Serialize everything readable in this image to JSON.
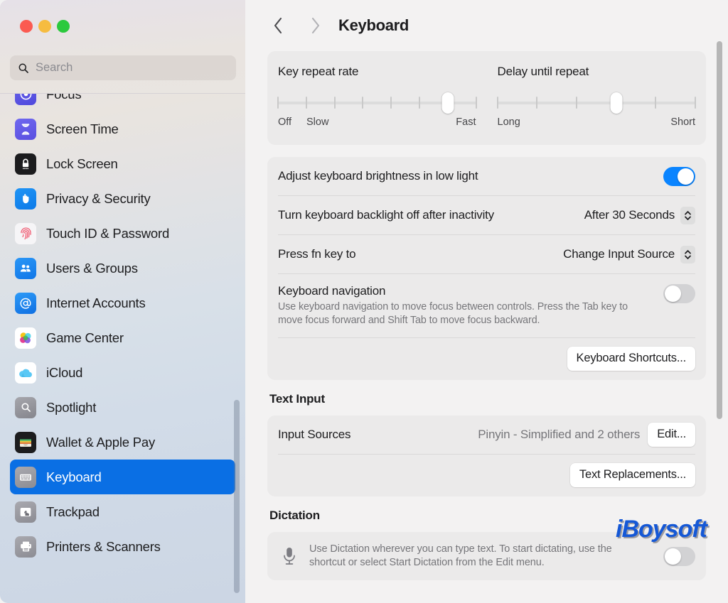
{
  "window": {
    "traffic_lights": [
      "close",
      "minimize",
      "zoom"
    ],
    "colors": {
      "accent": "#0a84ff",
      "selection": "#0a6fe4",
      "card": "#ebeaea",
      "watermark": "#1558d6"
    }
  },
  "sidebar": {
    "search": {
      "placeholder": "Search",
      "value": "",
      "icon": "search-icon"
    },
    "items": [
      {
        "label": "Focus",
        "icon": "focus-icon",
        "selected": false,
        "partial": true
      },
      {
        "label": "Screen Time",
        "icon": "screen-time-icon",
        "selected": false
      },
      {
        "label": "Lock Screen",
        "icon": "lock-icon",
        "selected": false
      },
      {
        "label": "Privacy & Security",
        "icon": "hand-icon",
        "selected": false
      },
      {
        "label": "Touch ID & Password",
        "icon": "fingerprint-icon",
        "selected": false
      },
      {
        "label": "Users & Groups",
        "icon": "users-icon",
        "selected": false
      },
      {
        "label": "Internet Accounts",
        "icon": "at-sign-icon",
        "selected": false
      },
      {
        "label": "Game Center",
        "icon": "game-center-icon",
        "selected": false
      },
      {
        "label": "iCloud",
        "icon": "cloud-icon",
        "selected": false
      },
      {
        "label": "Spotlight",
        "icon": "spotlight-icon",
        "selected": false
      },
      {
        "label": "Wallet & Apple Pay",
        "icon": "wallet-icon",
        "selected": false
      },
      {
        "label": "Keyboard",
        "icon": "keyboard-icon",
        "selected": true
      },
      {
        "label": "Trackpad",
        "icon": "trackpad-icon",
        "selected": false
      },
      {
        "label": "Printers & Scanners",
        "icon": "printer-icon",
        "selected": false
      }
    ]
  },
  "header": {
    "back_icon": "chevron-left-icon",
    "forward_icon": "chevron-right-icon",
    "title": "Keyboard"
  },
  "main": {
    "key_repeat": {
      "title": "Key repeat rate",
      "label_left": "Off",
      "label_second": "Slow",
      "label_right": "Fast",
      "ticks": 8,
      "value": 7
    },
    "delay_repeat": {
      "title": "Delay until repeat",
      "label_left": "Long",
      "label_right": "Short",
      "ticks": 6,
      "value": 4
    },
    "adjust_brightness": {
      "label": "Adjust keyboard brightness in low light",
      "toggle": "on"
    },
    "backlight_off": {
      "label": "Turn keyboard backlight off after inactivity",
      "value": "After 30 Seconds"
    },
    "press_fn": {
      "label": "Press fn key to",
      "value": "Change Input Source"
    },
    "keyboard_navigation": {
      "title": "Keyboard navigation",
      "description": "Use keyboard navigation to move focus between controls. Press the Tab key to move focus forward and Shift Tab to move focus backward.",
      "toggle": "off"
    },
    "keyboard_shortcuts_button": "Keyboard Shortcuts...",
    "text_input": {
      "section_title": "Text Input",
      "input_sources_label": "Input Sources",
      "input_sources_value": "Pinyin - Simplified and 2 others",
      "edit_button": "Edit...",
      "text_replacements_button": "Text Replacements..."
    },
    "dictation": {
      "section_title": "Dictation",
      "icon": "microphone-icon",
      "description": "Use Dictation wherever you can type text. To start dictating, use the shortcut or select Start Dictation from the Edit menu.",
      "toggle": "off"
    }
  },
  "watermark": {
    "text": "iBoysoft"
  }
}
